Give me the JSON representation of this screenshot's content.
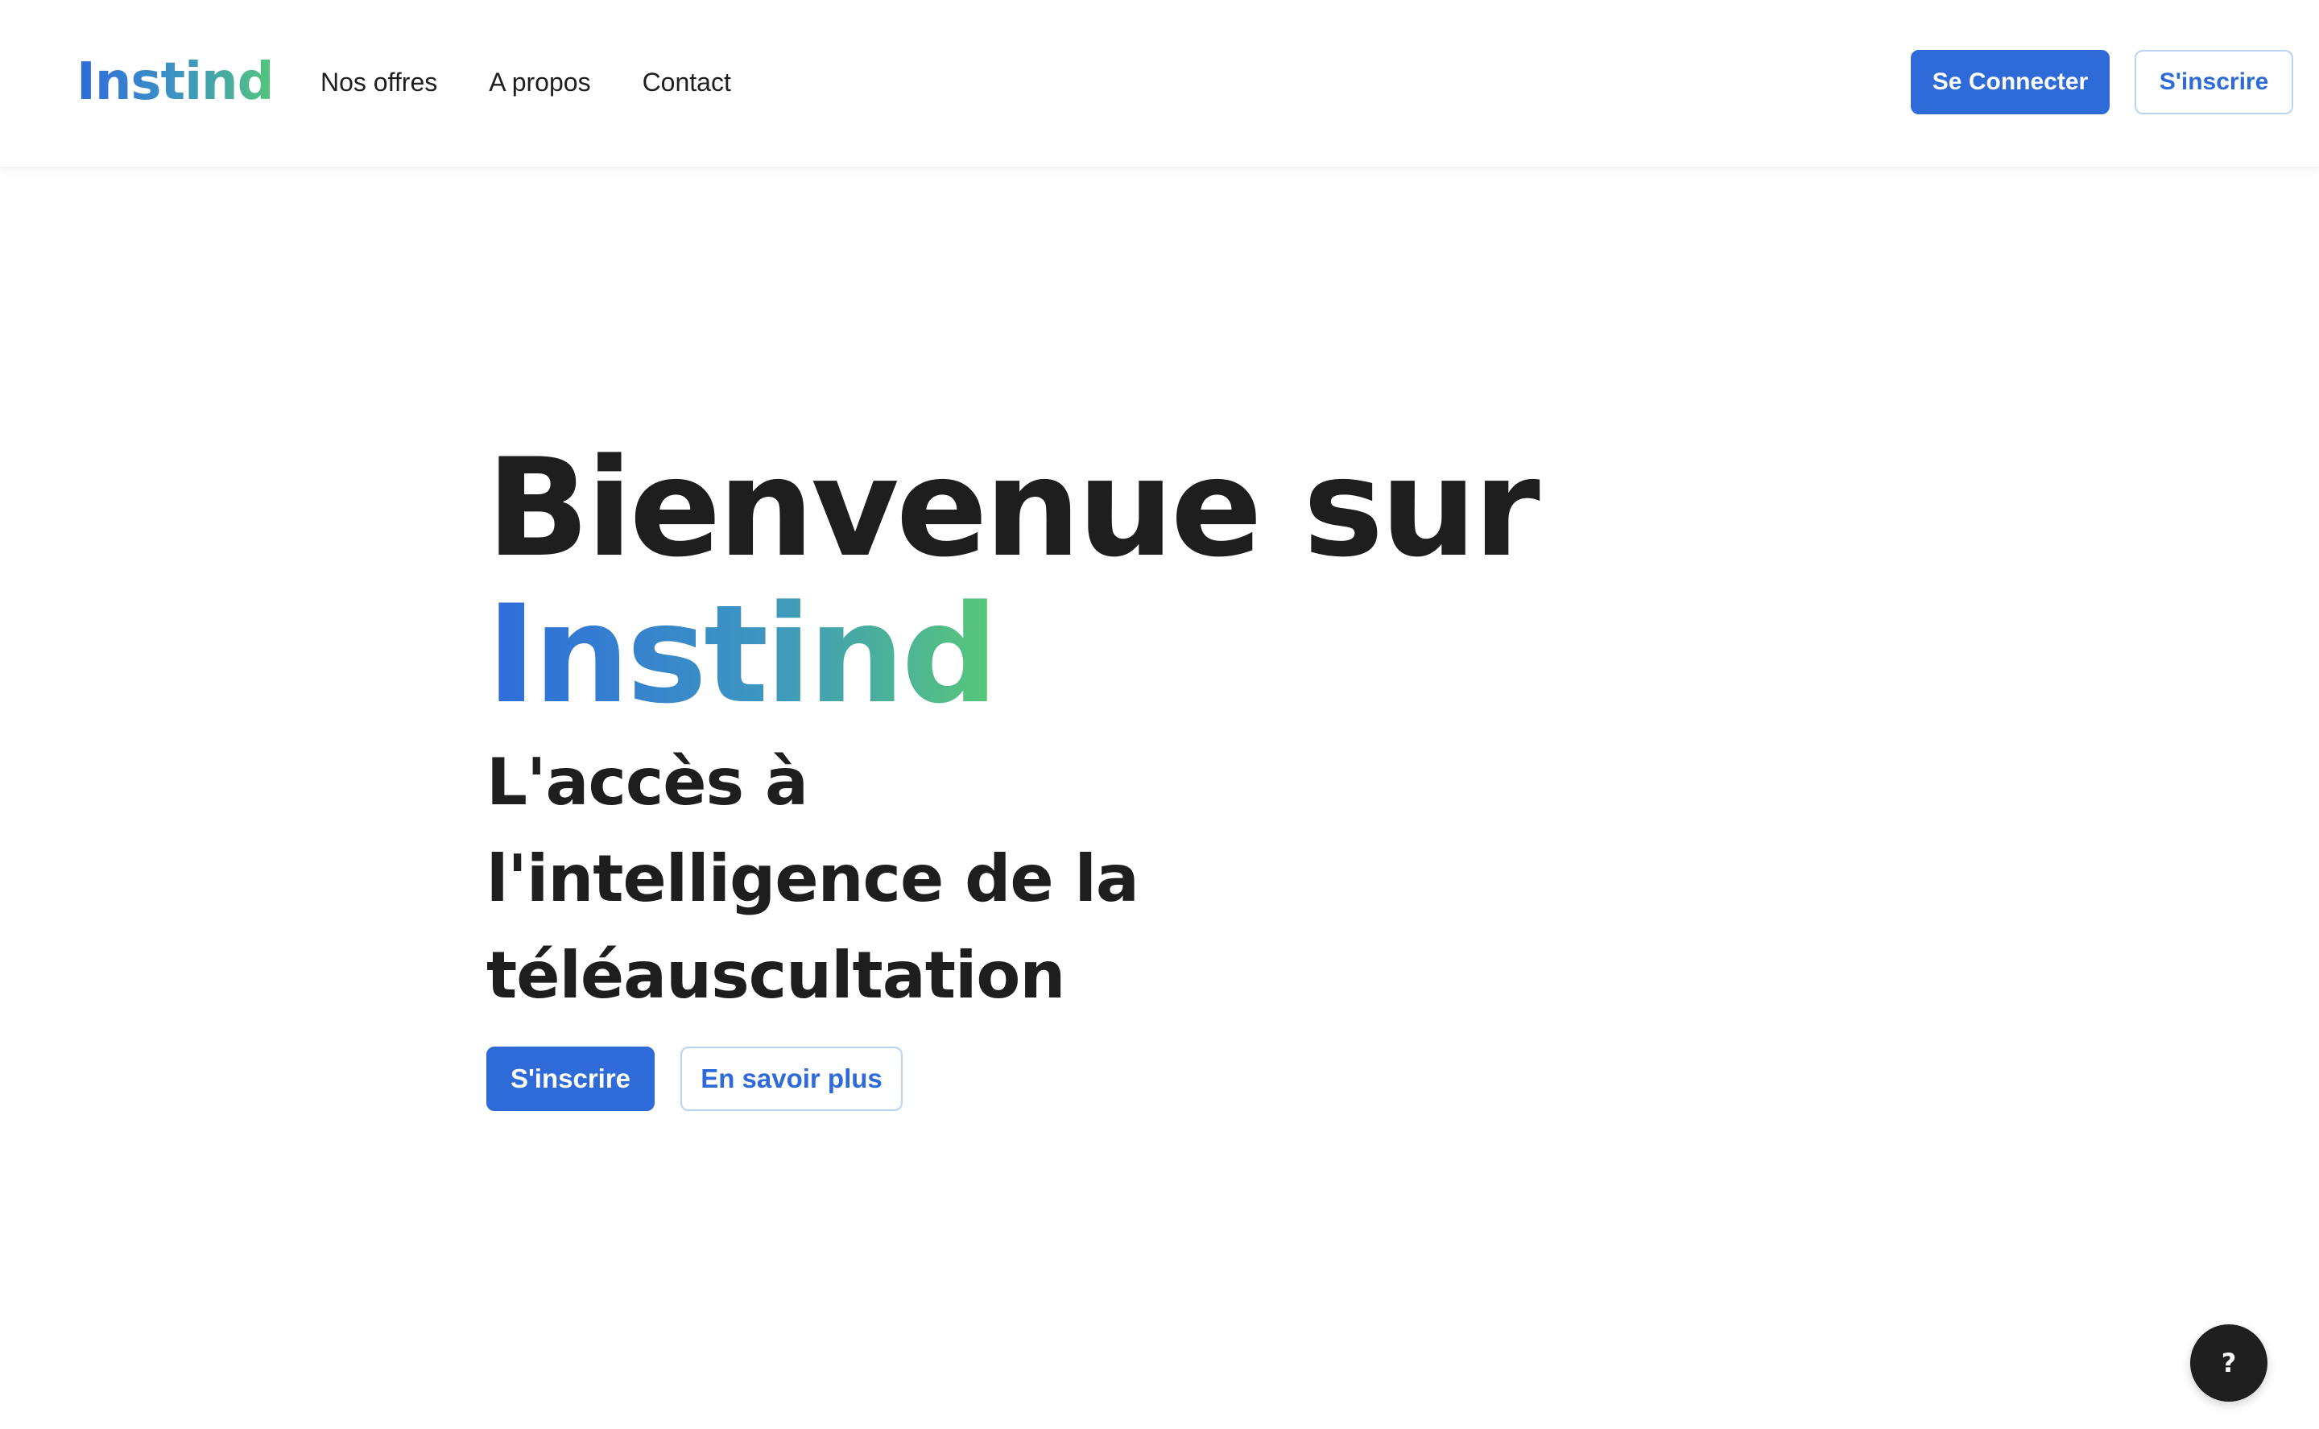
{
  "header": {
    "brand": "Instind",
    "nav": [
      {
        "label": "Nos offres"
      },
      {
        "label": "A propos"
      },
      {
        "label": "Contact"
      }
    ],
    "login_label": "Se Connecter",
    "signup_label": "S'inscrire"
  },
  "hero": {
    "title_line1": "Bienvenue sur",
    "title_brand": "Instind",
    "subtitle": "L'accès à l'intelligence de la téléauscultation",
    "primary_cta": "S'inscrire",
    "secondary_cta": "En savoir plus"
  },
  "help": {
    "label": "?",
    "icon": "question-mark-icon"
  },
  "colors": {
    "primary": "#2e6ad8",
    "brand_gradient_start": "#2f6bdc",
    "brand_gradient_mid": "#3d97c0",
    "brand_gradient_end": "#55c57a",
    "text": "#1e1e1e",
    "outline_border": "#b9d3f3",
    "fab": "#1f1f1f"
  }
}
